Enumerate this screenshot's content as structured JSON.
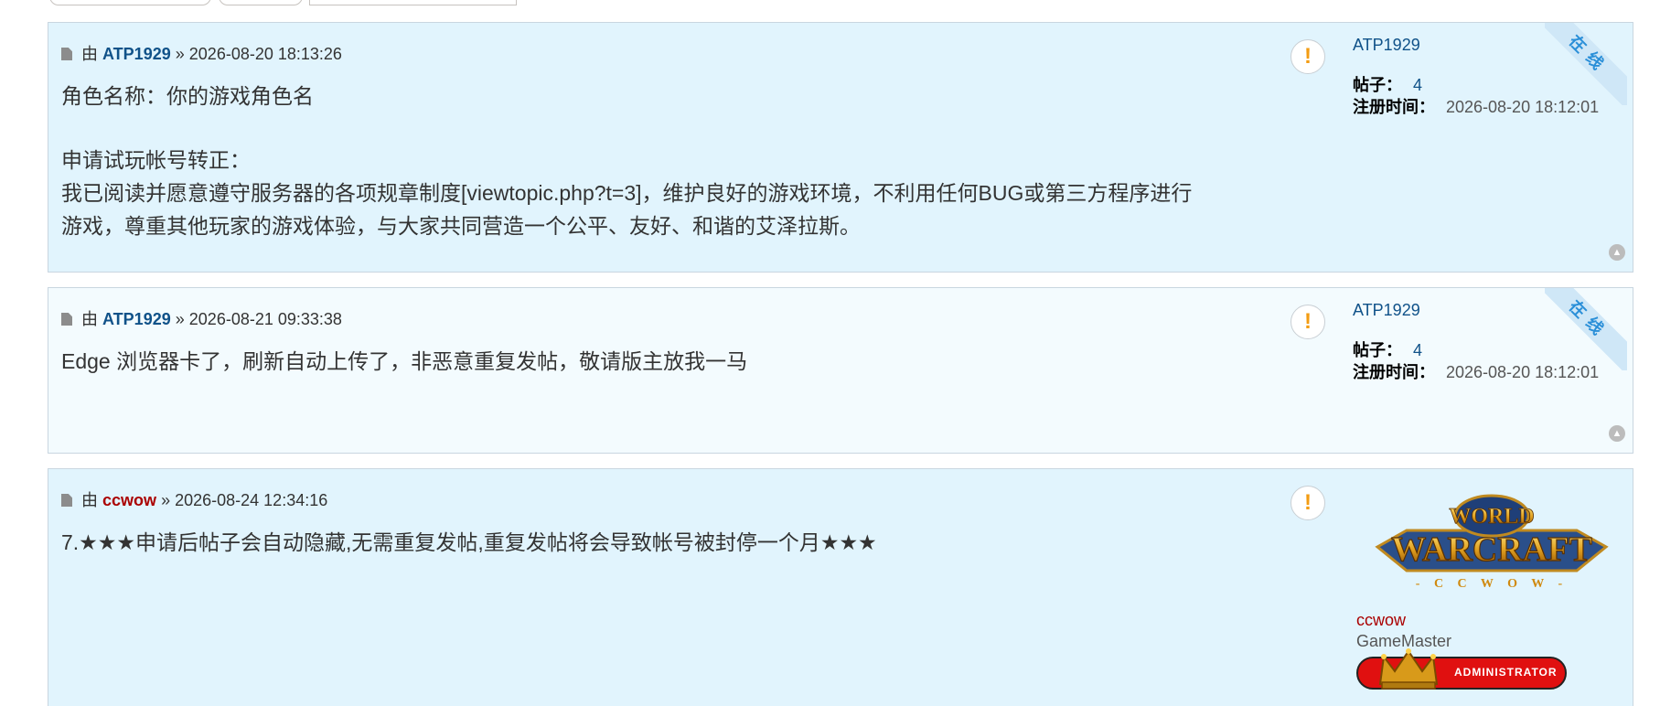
{
  "posts": [
    {
      "by_label": "由",
      "author": "ATP1929",
      "sep": "»",
      "datetime": "2026-08-20 18:13:26",
      "lines": [
        "角色名称：你的游戏角色名",
        "",
        "申请试玩帐号转正：",
        "我已阅读并愿意遵守服务器的各项规章制度[viewtopic.php?t=3]，维护良好的游戏环境，不利用任何BUG或第三方程序进行",
        "游戏，尊重其他玩家的游戏体验，与大家共同营造一个公平、友好、和谐的艾泽拉斯。"
      ],
      "profile": {
        "username": "ATP1929",
        "posts_label": "帖子：",
        "posts_value": "4",
        "reg_label": "注册时间：",
        "reg_value": "2026-08-20 18:12:01",
        "online_badge": "在线"
      }
    },
    {
      "by_label": "由",
      "author": "ATP1929",
      "sep": "»",
      "datetime": "2026-08-21 09:33:38",
      "lines": [
        "Edge 浏览器卡了，刷新自动上传了，非恶意重复发帖，敬请版主放我一马"
      ],
      "profile": {
        "username": "ATP1929",
        "posts_label": "帖子：",
        "posts_value": "4",
        "reg_label": "注册时间：",
        "reg_value": "2026-08-20 18:12:01",
        "online_badge": "在线"
      }
    },
    {
      "by_label": "由",
      "author": "ccwow",
      "sep": "»",
      "datetime": "2026-08-24 12:34:16",
      "lines": [
        "7.★★★申请后帖子会自动隐藏,无需重复发帖,重复发帖将会导致帐号被封停一个月★★★"
      ],
      "profile": {
        "username": "ccwow",
        "rank": "GameMaster",
        "logo_text_top": "WORLD",
        "logo_text_main": "WARCRAFT",
        "logo_text_sub": "- C C W O W -",
        "badge_text": "ADMINISTRATOR"
      }
    }
  ],
  "colors": {
    "link_blue": "#105289",
    "admin_red": "#aa0000",
    "post_bg_1": "#e1f4fd",
    "post_bg_2": "#f3fbfe",
    "report_icon": "#f39c12"
  },
  "icons": {
    "report": "exclamation-icon",
    "post": "file-icon",
    "back_to_top": "chevron-up-icon"
  },
  "report_glyph": "!",
  "top_glyph": "▲"
}
